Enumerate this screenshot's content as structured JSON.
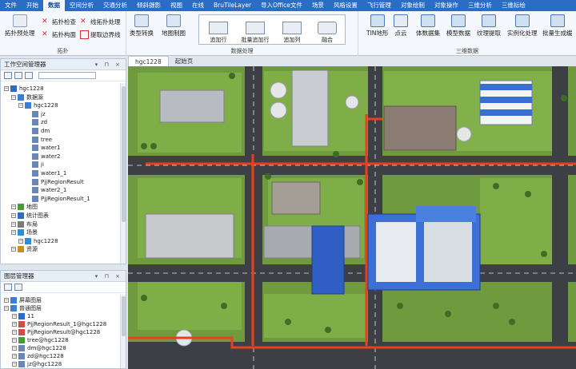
{
  "menu": {
    "tabs": [
      "文件",
      "开始",
      "数据",
      "空间分析",
      "交通分析",
      "倾斜摄影",
      "视图",
      "在线",
      "BruTileLayer",
      "导入Office文件",
      "场景",
      "风格设置",
      "飞行管理",
      "对象绘制",
      "对象操作",
      "三维分析",
      "三维标绘"
    ],
    "active_index": 2
  },
  "ribbon": {
    "topology": {
      "title": "拓扑",
      "preprocess": "拓扑预处理",
      "check": "拓扑检查",
      "build_polygon": "拓扑构面",
      "line_process": "线拓扑处理",
      "extract_boundary": "提取边界线"
    },
    "data_processing": {
      "title": "数据处理",
      "type_convert": "类型转换",
      "map_to_image": "地图制图",
      "append_row": "追加行",
      "batch_append_row": "批量追加行",
      "append_column": "追加列",
      "fuse": "融合"
    },
    "three_d": {
      "title": "三维数据",
      "tin": "TIN地形",
      "point_cloud": "点云",
      "volume_dataset": "体数据集",
      "model_dataset": "模型数据",
      "texture_extract": "纹理提取",
      "instance_process": "实例化处理",
      "batch_cache": "批量生成缓"
    }
  },
  "workspace_panel": {
    "title": "工作空间管理器",
    "controls": "▾ ⊓ ×",
    "items": [
      {
        "label": "hgc1228",
        "level": 0,
        "icon": "#2b6cc4"
      },
      {
        "label": "数据源",
        "level": 1,
        "icon": "#3a7fd5"
      },
      {
        "label": "hgc1228",
        "level": 2,
        "icon": "#3a7fd5"
      },
      {
        "label": "jz",
        "level": 3,
        "icon": "#6a86b5"
      },
      {
        "label": "zd",
        "level": 3,
        "icon": "#6a86b5"
      },
      {
        "label": "dm",
        "level": 3,
        "icon": "#6a86b5"
      },
      {
        "label": "tree",
        "level": 3,
        "icon": "#6a86b5"
      },
      {
        "label": "water1",
        "level": 3,
        "icon": "#6a86b5"
      },
      {
        "label": "water2",
        "level": 3,
        "icon": "#6a86b5"
      },
      {
        "label": "ji",
        "level": 3,
        "icon": "#6a86b5"
      },
      {
        "label": "water1_1",
        "level": 3,
        "icon": "#6a86b5"
      },
      {
        "label": "PjjRegionResult",
        "level": 3,
        "icon": "#6a86b5"
      },
      {
        "label": "water2_1",
        "level": 3,
        "icon": "#6a86b5"
      },
      {
        "label": "PjjRegionResult_1",
        "level": 3,
        "icon": "#6a86b5"
      },
      {
        "label": "地图",
        "level": 1,
        "icon": "#4a9a3a"
      },
      {
        "label": "统计图表",
        "level": 1,
        "icon": "#2b6cc4"
      },
      {
        "label": "布局",
        "level": 1,
        "icon": "#7a7a7a"
      },
      {
        "label": "场景",
        "level": 1,
        "icon": "#2b8fd5"
      },
      {
        "label": "hgc1228",
        "level": 2,
        "icon": "#2b8fd5"
      },
      {
        "label": "资源",
        "level": 1,
        "icon": "#c89020"
      }
    ]
  },
  "layer_panel": {
    "title": "图层管理器",
    "controls": "▾ ⊓ ×",
    "items": [
      {
        "label": "屏幕图层",
        "level": 0,
        "icon": "#3a7fd5"
      },
      {
        "label": "普通图层",
        "level": 0,
        "icon": "#3a7fd5"
      },
      {
        "label": "11",
        "level": 1,
        "icon": "#2b6cc4"
      },
      {
        "label": "PjjRegionResult_1@hgc1228",
        "level": 1,
        "icon": "#d54a4a"
      },
      {
        "label": "PjjRegionResult@hgc1228",
        "level": 1,
        "icon": "#d54a4a"
      },
      {
        "label": "tree@hgc1228",
        "level": 1,
        "icon": "#4a9a3a"
      },
      {
        "label": "dm@hgc1228",
        "level": 1,
        "icon": "#6a86b5"
      },
      {
        "label": "zd@hgc1228",
        "level": 1,
        "icon": "#6a86b5"
      },
      {
        "label": "jz@hgc1228",
        "level": 1,
        "icon": "#6a86b5"
      }
    ]
  },
  "doc_tabs": [
    "hgc1228",
    "起始页"
  ],
  "colors": {
    "ribbon_blue": "#2b6cc4",
    "pipeline_red": "#e8401c",
    "grass": "#6f9a3e",
    "road": "#3d3f45"
  }
}
